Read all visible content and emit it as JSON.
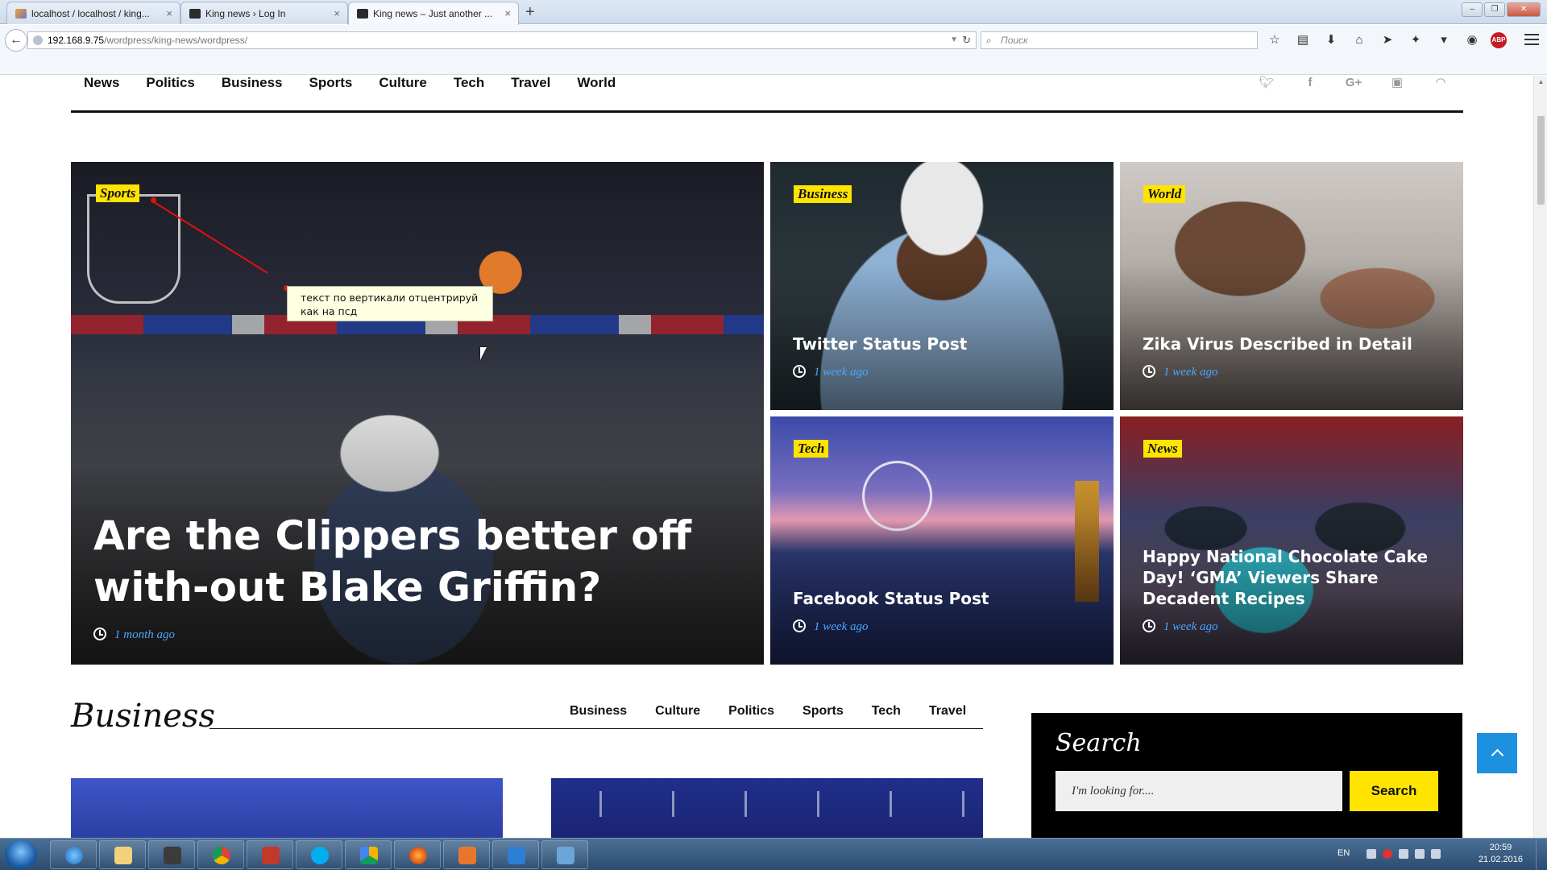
{
  "browser": {
    "tabs": [
      {
        "title": "localhost / localhost / king...",
        "icon": "phpmyadmin-icon"
      },
      {
        "title": "King news › Log In",
        "icon": "wordpress-icon"
      },
      {
        "title": "King news – Just another ...",
        "icon": "wordpress-icon"
      }
    ],
    "url_host": "192.168.9.75",
    "url_path": "/wordpress/king-news/wordpress/",
    "search_placeholder": "Поиск"
  },
  "site": {
    "nav": [
      "News",
      "Politics",
      "Business",
      "Sports",
      "Culture",
      "Tech",
      "Travel",
      "World"
    ],
    "social": [
      "twitter-icon",
      "facebook-icon",
      "google-plus-icon",
      "youtube-icon",
      "rss-icon"
    ]
  },
  "featured": {
    "main": {
      "category": "Sports",
      "title": "Are the Clippers better off with-out Blake Griffin?",
      "time": "1 month ago"
    },
    "side": [
      {
        "category": "Business",
        "title": "Twitter Status Post",
        "time": "1 week ago"
      },
      {
        "category": "World",
        "title": "Zika Virus Described in Detail",
        "time": "1 week ago"
      },
      {
        "category": "Tech",
        "title": "Facebook Status Post",
        "time": "1 week ago"
      },
      {
        "category": "News",
        "title": "Happy National Chocolate Cake Day! ‘GMA’ Viewers Share Decadent Recipes",
        "time": "1 week ago"
      }
    ]
  },
  "annotation": {
    "text": "текст по вертикали отцентрируй как на псд"
  },
  "business_section": {
    "title": "Business",
    "tabs": [
      "Business",
      "Culture",
      "Politics",
      "Sports",
      "Tech",
      "Travel"
    ]
  },
  "search_widget": {
    "title": "Search",
    "placeholder": "I'm looking for....",
    "button": "Search"
  },
  "taskbar": {
    "lang": "EN",
    "time": "20:59",
    "date": "21.02.2016"
  },
  "colors": {
    "accent_yellow": "#ffe400",
    "meta_blue": "#4aa6ff",
    "to_top_blue": "#1e90e0"
  }
}
